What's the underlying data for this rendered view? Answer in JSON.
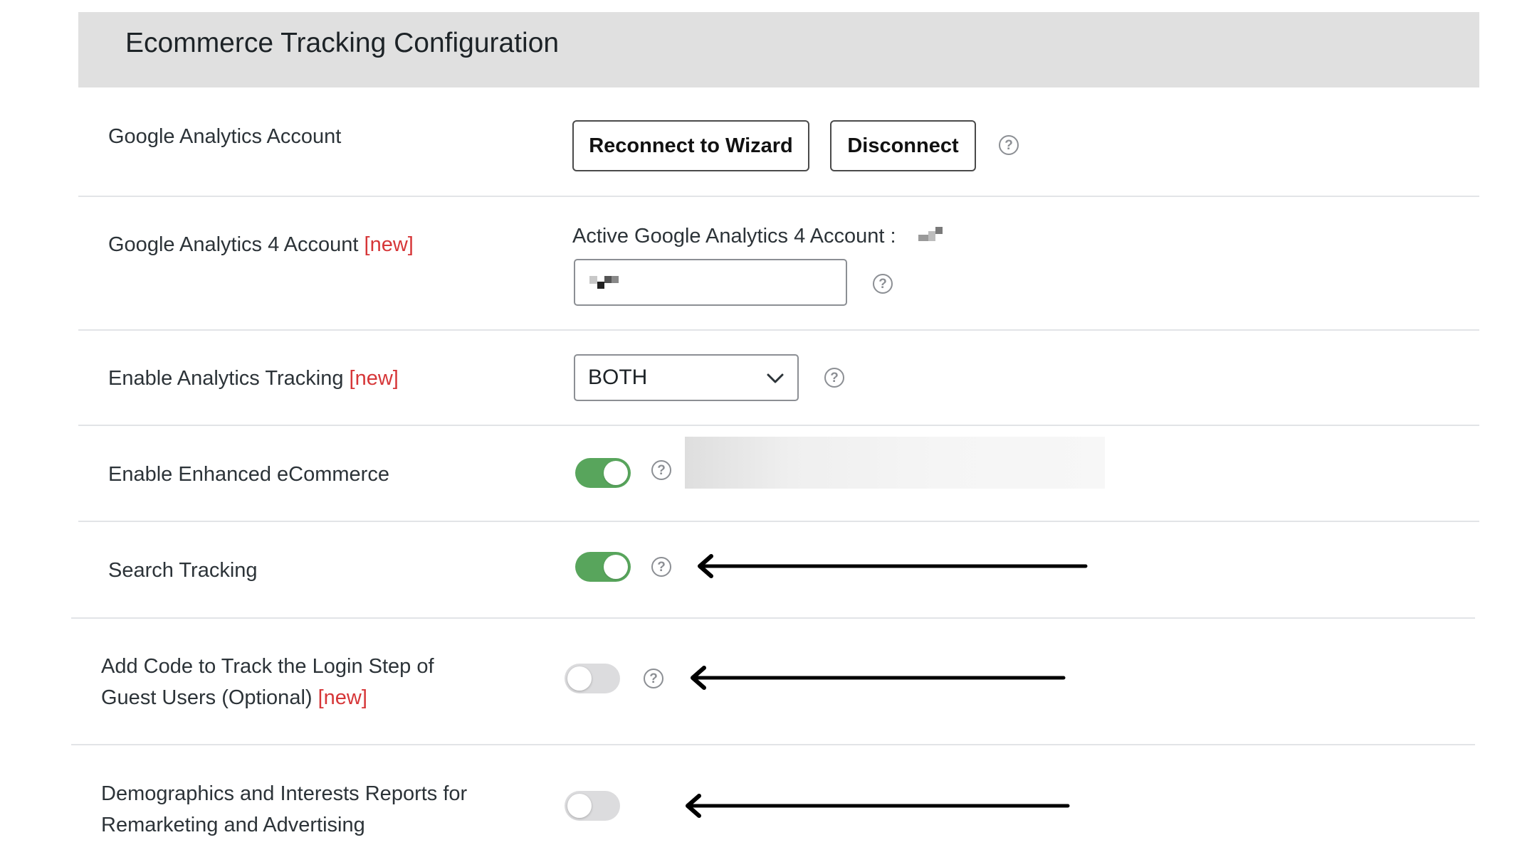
{
  "header": {
    "title": "Ecommerce Tracking Configuration"
  },
  "rows": {
    "ga_account": {
      "label": "Google Analytics Account",
      "reconnect_label": "Reconnect to Wizard",
      "disconnect_label": "Disconnect"
    },
    "ga4_account": {
      "label": "Google Analytics 4 Account",
      "new_badge": "[new]",
      "active_text": "Active Google Analytics 4 Account :"
    },
    "analytics_tracking": {
      "label": "Enable Analytics Tracking",
      "new_badge": "[new]",
      "selected": "BOTH"
    },
    "enhanced_ecommerce": {
      "label": "Enable Enhanced eCommerce",
      "enabled": true
    },
    "search_tracking": {
      "label": "Search Tracking",
      "enabled": true
    },
    "login_step": {
      "label_line1": "Add Code to Track the Login Step of",
      "label_line2": "Guest Users (Optional)",
      "new_badge": "[new]",
      "enabled": false
    },
    "demographics": {
      "label_line1": "Demographics and Interests Reports for",
      "label_line2": "Remarketing and Advertising",
      "enabled": false
    }
  },
  "help_glyph": "?",
  "icons": [
    "help-icon",
    "chevron-down-icon",
    "arrow-left-icon"
  ],
  "colors": {
    "toggle_on": "#58a55c",
    "toggle_off": "#dcdcde",
    "new_badge": "#d63638",
    "header_bg": "#e0e0e0"
  }
}
